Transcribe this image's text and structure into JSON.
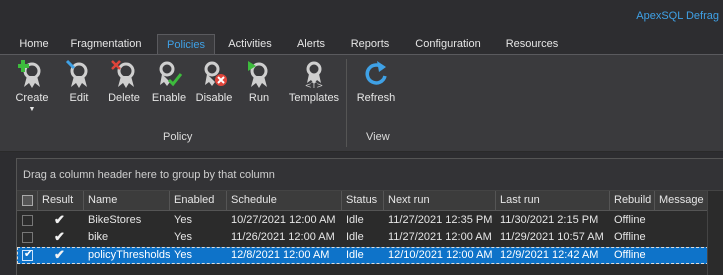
{
  "app": {
    "title": "ApexSQL Defrag"
  },
  "tabs": [
    {
      "label": "Home"
    },
    {
      "label": "Fragmentation"
    },
    {
      "label": "Policies"
    },
    {
      "label": "Activities"
    },
    {
      "label": "Alerts"
    },
    {
      "label": "Reports"
    },
    {
      "label": "Configuration"
    },
    {
      "label": "Resources"
    }
  ],
  "ribbon": {
    "policy_group": "Policy",
    "view_group": "View",
    "buttons": {
      "create": "Create",
      "edit": "Edit",
      "delete": "Delete",
      "enable": "Enable",
      "disable": "Disable",
      "run": "Run",
      "templates": "Templates",
      "refresh": "Refresh"
    }
  },
  "grid": {
    "group_hint": "Drag a column header here to group by that column",
    "columns": [
      "Result",
      "Name",
      "Enabled",
      "Schedule",
      "Status",
      "Next run",
      "Last run",
      "Rebuild",
      "Message"
    ],
    "result_mark": "✔",
    "check_mark": "✔",
    "rows": [
      {
        "checked": false,
        "selected": false,
        "name": "BikeStores",
        "enabled": "Yes",
        "schedule": "10/27/2021 12:00 AM",
        "status": "Idle",
        "next_run": "11/27/2021 12:35 PM",
        "last_run": "11/30/2021 2:15 PM",
        "rebuild": "Offline",
        "message": ""
      },
      {
        "checked": false,
        "selected": false,
        "name": "bike",
        "enabled": "Yes",
        "schedule": "11/26/2021 12:00 AM",
        "status": "Idle",
        "next_run": "11/27/2021 12:00 AM",
        "last_run": "11/29/2021 10:57 AM",
        "rebuild": "Offline",
        "message": ""
      },
      {
        "checked": true,
        "selected": true,
        "name": "policyThresholds",
        "enabled": "Yes",
        "schedule": "12/8/2021 12:00 AM",
        "status": "Idle",
        "next_run": "12/10/2021 12:00 AM",
        "last_run": "12/9/2021 12:42 AM",
        "rebuild": "Offline",
        "message": ""
      }
    ]
  },
  "colors": {
    "accent": "#3fa1e6",
    "selection": "#0e73c9",
    "ribbon_bg": "#3a3a3d",
    "app_bg": "#2d2d30"
  }
}
